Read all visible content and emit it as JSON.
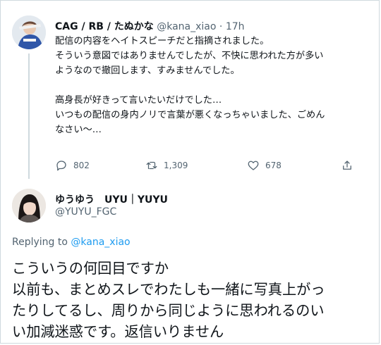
{
  "tweet": {
    "author_name": "CAG / RB / たぬかな",
    "handle": "@kana_xiao",
    "separator": "·",
    "time": "17h",
    "lines": [
      "配信の内容をヘイトスピーチだと指摘されました。",
      "そういう意図ではありませんでしたが、不快に思われた方が多い",
      "ようなので撤回します、すみませんでした。",
      "高身長が好きって言いたいだけでした…",
      "いつもの配信の身内ノリで言葉が悪くなっちゃいました、ごめん",
      "なさい〜…"
    ],
    "reply_count": "802",
    "retweet_count": "1,309",
    "like_count": "678"
  },
  "reply": {
    "author_name": "ゆうゆう　UYU｜YUYU",
    "handle": "@YUYU_FGC",
    "replying_to_label": "Replying to",
    "replying_to_handle": "@kana_xiao",
    "lines": [
      "こういうの何回目ですか",
      "以前も、まとめスレでわたしも一緒に写真上がっ",
      "たりしてるし、周りから同じように思われるのい",
      "い加減迷惑です。返信いりません"
    ]
  },
  "colors": {
    "text": "#0f1419",
    "muted": "#536471",
    "link": "#1d9bf0",
    "border": "#cfd9de"
  },
  "icons": [
    "reply-icon",
    "retweet-icon",
    "like-icon",
    "share-icon"
  ]
}
